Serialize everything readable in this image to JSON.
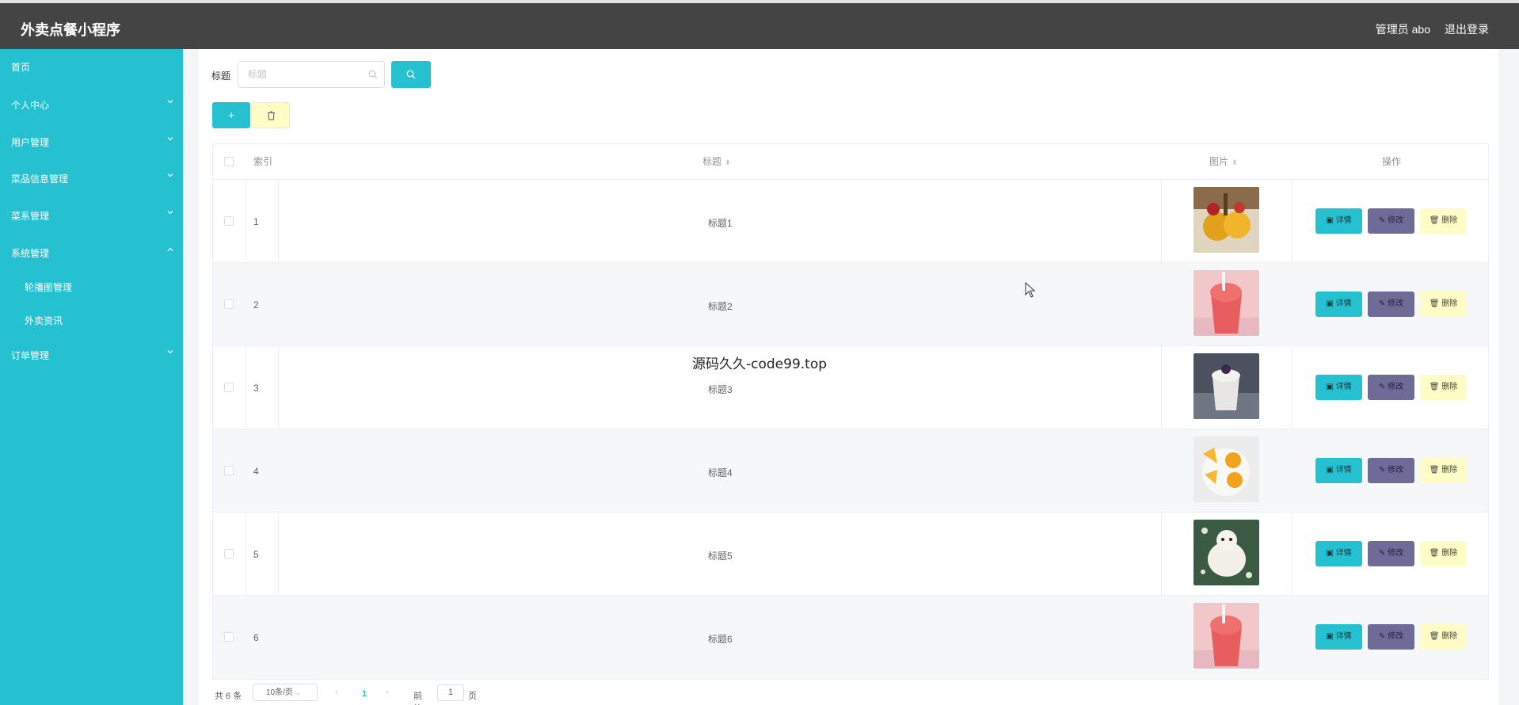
{
  "app": {
    "title": "外卖点餐小程序"
  },
  "header": {
    "user_label": "管理员 abo",
    "logout_label": "退出登录"
  },
  "sidebar": {
    "items": [
      {
        "label": "首页",
        "has_chevron": false
      },
      {
        "label": "个人中心",
        "has_chevron": true
      },
      {
        "label": "用户管理",
        "has_chevron": true
      },
      {
        "label": "菜品信息管理",
        "has_chevron": true
      },
      {
        "label": "菜系管理",
        "has_chevron": true
      },
      {
        "label": "系统管理",
        "has_chevron": true,
        "expanded": true
      },
      {
        "label": "轮播图管理",
        "sub": true
      },
      {
        "label": "外卖资讯",
        "sub": true
      },
      {
        "label": "订单管理",
        "has_chevron": true
      }
    ]
  },
  "filter": {
    "label": "标题",
    "placeholder": "标题"
  },
  "table": {
    "columns": {
      "index": "索引",
      "title": "标题",
      "image": "图片",
      "actions": "操作"
    },
    "rows": [
      {
        "index": "1",
        "title": "标题1",
        "image": "food-photo"
      },
      {
        "index": "2",
        "title": "标题2",
        "image": "food-photo"
      },
      {
        "index": "3",
        "title": "标题3",
        "image": "food-photo"
      },
      {
        "index": "4",
        "title": "标题4",
        "image": "food-photo"
      },
      {
        "index": "5",
        "title": "标题5",
        "image": "food-photo"
      },
      {
        "index": "6",
        "title": "标题6",
        "image": "food-photo"
      }
    ],
    "actions": {
      "detail": "详情",
      "edit": "修改",
      "delete": "删除"
    }
  },
  "pagination": {
    "total": "共 6 条",
    "page_size": "10条/页",
    "current_page": "1",
    "goto_label": "前往",
    "goto_value": "1",
    "page_unit": "页"
  },
  "overlay": {
    "text": "源码久久-code99.top"
  },
  "colors": {
    "accent": "#25c1d1",
    "header": "#444444",
    "edit": "#6e6b99",
    "delete": "#fdfdc5"
  }
}
